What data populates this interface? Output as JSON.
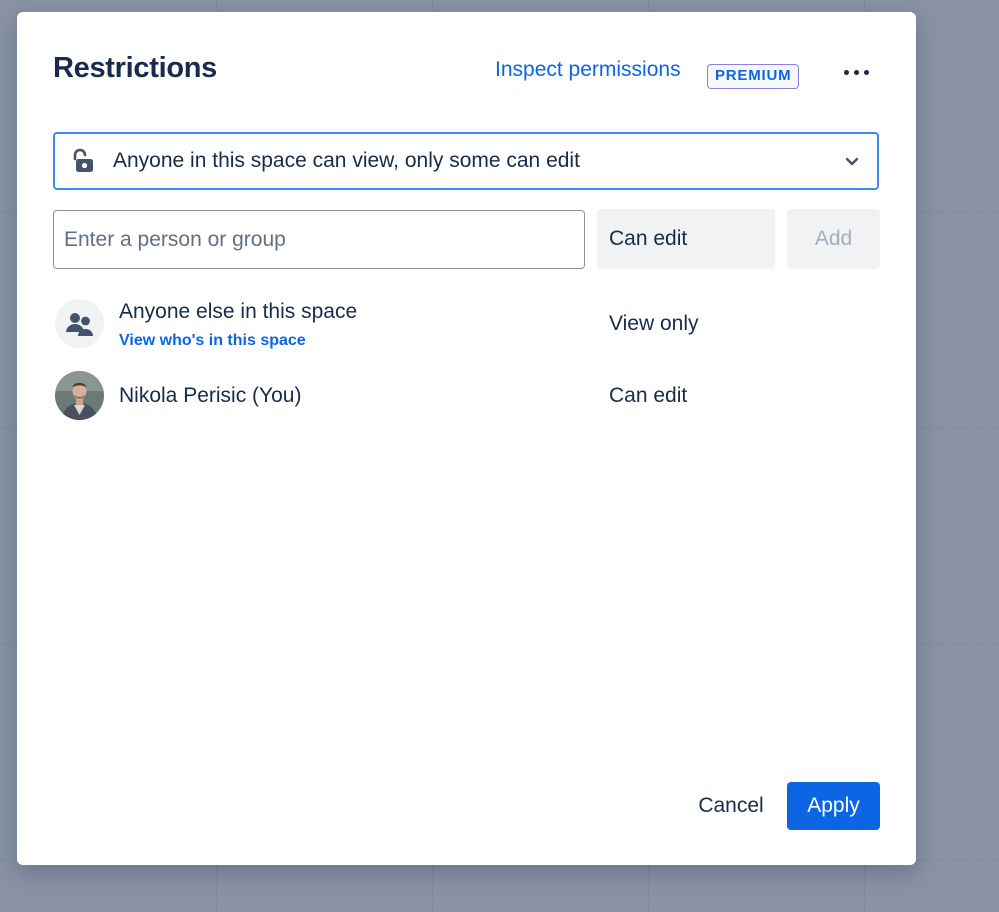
{
  "dialog": {
    "title": "Restrictions",
    "inspect_link": "Inspect permissions",
    "premium_badge": "PREMIUM",
    "more_icon": "more-horizontal-icon"
  },
  "restriction_select": {
    "icon": "unlock-icon",
    "selected": "Anyone in this space can view, only some can edit",
    "chevron_icon": "chevron-down-icon"
  },
  "add_person": {
    "placeholder": "Enter a person or group",
    "value": "",
    "permission": "Can edit",
    "add_label": "Add"
  },
  "entries": [
    {
      "name": "Anyone else in this space",
      "link": "View who's in this space",
      "permission": "View only",
      "avatar": "group-icon"
    },
    {
      "name": "Nikola Perisic (You)",
      "permission": "Can edit",
      "avatar": "user-avatar"
    }
  ],
  "footer": {
    "cancel_label": "Cancel",
    "apply_label": "Apply"
  },
  "colors": {
    "backdrop": "#8993a4",
    "primary": "#0c66e4",
    "focus_border": "#388bff",
    "text": "#172b4d",
    "premium_border": "#8f7ee7"
  }
}
